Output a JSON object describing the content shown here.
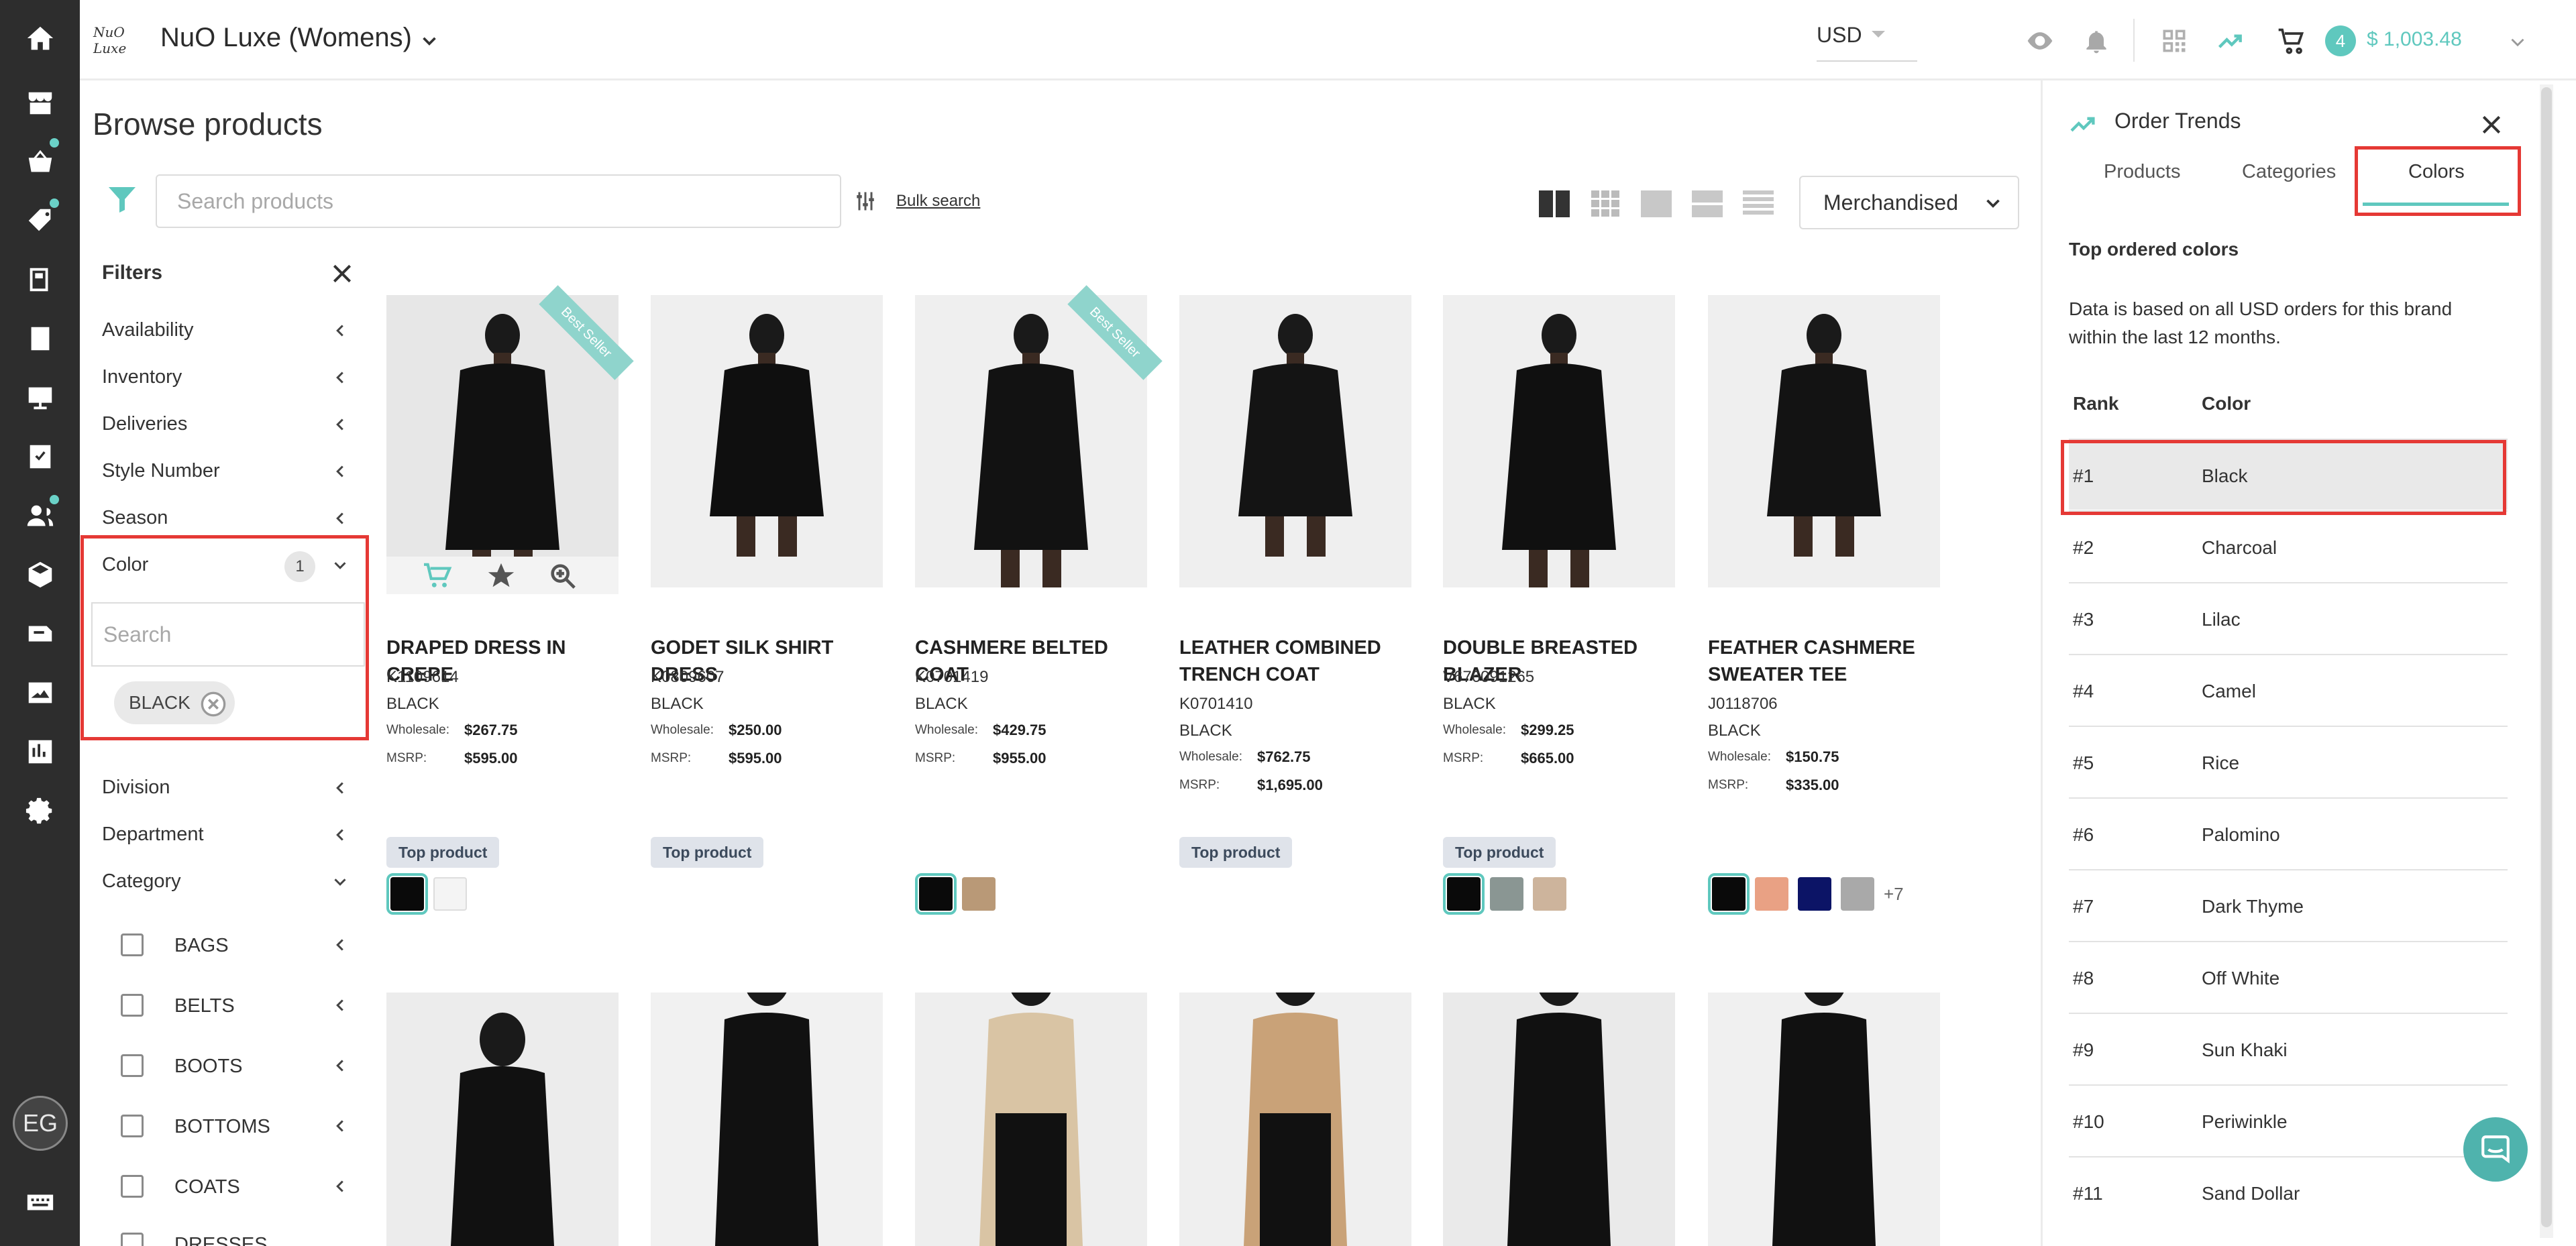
{
  "header": {
    "brand_logo_text": "NuO Luxe",
    "brand_name": "NuO Luxe (Womens)",
    "currency": "USD",
    "cart_count": "4",
    "cart_total": "$ 1,003.48"
  },
  "user": {
    "initials": "EG"
  },
  "page": {
    "title": "Browse products",
    "search_placeholder": "Search products",
    "bulk_search": "Bulk search",
    "sort": "Merchandised"
  },
  "filters": {
    "title": "Filters",
    "items": [
      {
        "label": "Availability"
      },
      {
        "label": "Inventory"
      },
      {
        "label": "Deliveries"
      },
      {
        "label": "Style Number"
      },
      {
        "label": "Season"
      }
    ],
    "color": {
      "label": "Color",
      "count": "1",
      "search_placeholder": "Search",
      "chip": "BLACK"
    },
    "items2": [
      {
        "label": "Division"
      },
      {
        "label": "Department"
      },
      {
        "label": "Category"
      }
    ],
    "categories": [
      {
        "label": "BAGS"
      },
      {
        "label": "BELTS"
      },
      {
        "label": "BOOTS"
      },
      {
        "label": "BOTTOMS"
      },
      {
        "label": "COATS"
      },
      {
        "label": "DRESSES"
      }
    ]
  },
  "products": [
    {
      "name": "DRAPED DRESS IN CREPE",
      "sku": "K1109614",
      "color": "BLACK",
      "wholesale_label": "Wholesale:",
      "wholesale": "$267.75",
      "msrp_label": "MSRP:",
      "msrp": "$595.00",
      "badge": "Top product",
      "ribbon": "Best Seller"
    },
    {
      "name": "GODET SILK SHIRT DRESS",
      "sku": "K0809607",
      "color": "BLACK",
      "wholesale_label": "Wholesale:",
      "wholesale": "$250.00",
      "msrp_label": "MSRP:",
      "msrp": "$595.00",
      "badge": "Top product"
    },
    {
      "name": "CASHMERE BELTED COAT",
      "sku": "K0701419",
      "color": "BLACK",
      "wholesale_label": "Wholesale:",
      "wholesale": "$429.75",
      "msrp_label": "MSRP:",
      "msrp": "$955.00",
      "ribbon": "Best Seller"
    },
    {
      "name": "LEATHER COMBINED TRENCH COAT",
      "sku": "K0701410",
      "color": "BLACK",
      "wholesale_label": "Wholesale:",
      "wholesale": "$762.75",
      "msrp_label": "MSRP:",
      "msrp": "$1,695.00",
      "badge": "Top product"
    },
    {
      "name": "DOUBLE BREASTED BLAZER",
      "sku": "V676091265",
      "color": "BLACK",
      "wholesale_label": "Wholesale:",
      "wholesale": "$299.25",
      "msrp_label": "MSRP:",
      "msrp": "$665.00",
      "badge": "Top product"
    },
    {
      "name": "FEATHER CASHMERE SWEATER TEE",
      "sku": "J0118706",
      "color": "BLACK",
      "wholesale_label": "Wholesale:",
      "wholesale": "$150.75",
      "msrp_label": "MSRP:",
      "msrp": "$335.00",
      "more_colors": "+7"
    }
  ],
  "swatch_colors": {
    "p1": [
      "#0a0a0a",
      "#f4f4f4"
    ],
    "p3": [
      "#0a0a0a",
      "#b99977"
    ],
    "p5": [
      "#0a0a0a",
      "#8a9693",
      "#cdb49c"
    ],
    "p6": [
      "#0a0a0a",
      "#e9a184",
      "#0c1466",
      "#a9a9a9"
    ]
  },
  "panel": {
    "title": "Order Trends",
    "tabs": [
      "Products",
      "Categories",
      "Colors"
    ],
    "subtitle": "Top ordered colors",
    "description": "Data is based on all USD orders for this brand within the last 12 months.",
    "col_rank": "Rank",
    "col_color": "Color",
    "rows": [
      {
        "rank": "#1",
        "color": "Black"
      },
      {
        "rank": "#2",
        "color": "Charcoal"
      },
      {
        "rank": "#3",
        "color": "Lilac"
      },
      {
        "rank": "#4",
        "color": "Camel"
      },
      {
        "rank": "#5",
        "color": "Rice"
      },
      {
        "rank": "#6",
        "color": "Palomino"
      },
      {
        "rank": "#7",
        "color": "Dark Thyme"
      },
      {
        "rank": "#8",
        "color": "Off White"
      },
      {
        "rank": "#9",
        "color": "Sun Khaki"
      },
      {
        "rank": "#10",
        "color": "Periwinkle"
      },
      {
        "rank": "#11",
        "color": "Sand Dollar"
      }
    ]
  },
  "colors": {
    "accent": "#5fc8be",
    "highlight_border": "#e53935",
    "rail": "#2d2d2d"
  }
}
